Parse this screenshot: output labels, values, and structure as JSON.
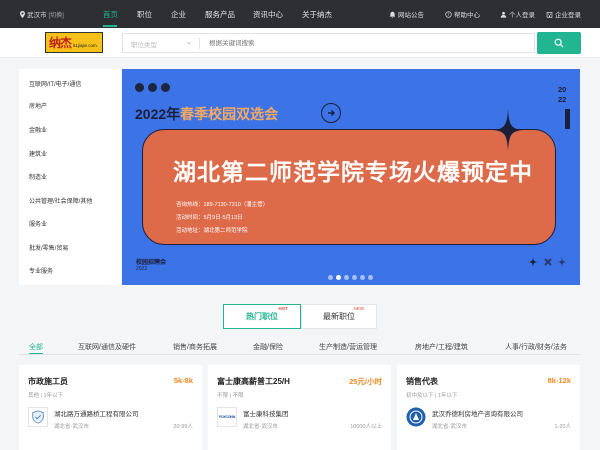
{
  "topbar": {
    "city": "武汉市",
    "city_switch": "[切换]",
    "nav": [
      "首页",
      "职位",
      "企业",
      "服务产品",
      "资讯中心",
      "关于纳杰"
    ],
    "announcement": "网站公告",
    "help": "帮助中心",
    "personal_login": "个人登录",
    "company_login": "企业登录"
  },
  "logo": {
    "big": "纳杰",
    "small": "51jiajie.com"
  },
  "search": {
    "type": "职位类型",
    "placeholder": "根据关键词搜索"
  },
  "categories": [
    "互联网/IT/电子/通信",
    "房地产",
    "金融业",
    "建筑业",
    "制造业",
    "公共管理/社会保障/其他",
    "服务业",
    "批发/零售/贸易",
    "专业服务"
  ],
  "banner": {
    "headline_year": "2022年",
    "headline_highlight": "春季校园双选会",
    "year_top": "20",
    "year_bottom": "22",
    "main_title": "湖北第二师范学院专场火爆预定中",
    "hotline": "咨询热线：189-7130-7310（潘主管）",
    "time": "活动时间：5月9日-5月13日",
    "place": "活动地址：湖北第二师范学院",
    "footer_title": "校园招聘会",
    "footer_year": "2022"
  },
  "tabs": {
    "hot": "热门职位",
    "hot_badge": "HOT",
    "new": "最新职位",
    "new_badge": "NEW"
  },
  "filters": [
    "全部",
    "互联网/通信及硬件",
    "销售/商务拓展",
    "金融/保险",
    "生产制造/营运管理",
    "房地产/工程/建筑",
    "人事/行政/财务/法务"
  ],
  "jobs": [
    {
      "title": "市政施工员",
      "salary": "5k-8k",
      "requirements": "其他 | 1年以下",
      "company": "湖北路万通路桥工程有限公司",
      "location": "湖北省-武汉市",
      "size": "20-99人"
    },
    {
      "title": "富士康高薪普工25/H",
      "salary": "25元/小时",
      "requirements": "不限 | 不限",
      "company": "富士康科技集团",
      "location": "湖北省-武汉市",
      "size": "10000人以上",
      "logo_text": "FOXCONN"
    },
    {
      "title": "销售代表",
      "salary": "8k-12k",
      "requirements": "初中及以下 | 1年以下",
      "company": "武汉乔德利房地产咨询有限公司",
      "location": "湖北省-武汉市",
      "size": "1-20人"
    }
  ],
  "colors": {
    "accent": "#21b591",
    "salary": "#f08a24",
    "banner_blue": "#3c73e6",
    "banner_orange": "#dd6b4a",
    "nav_bg": "#2d2f33"
  }
}
